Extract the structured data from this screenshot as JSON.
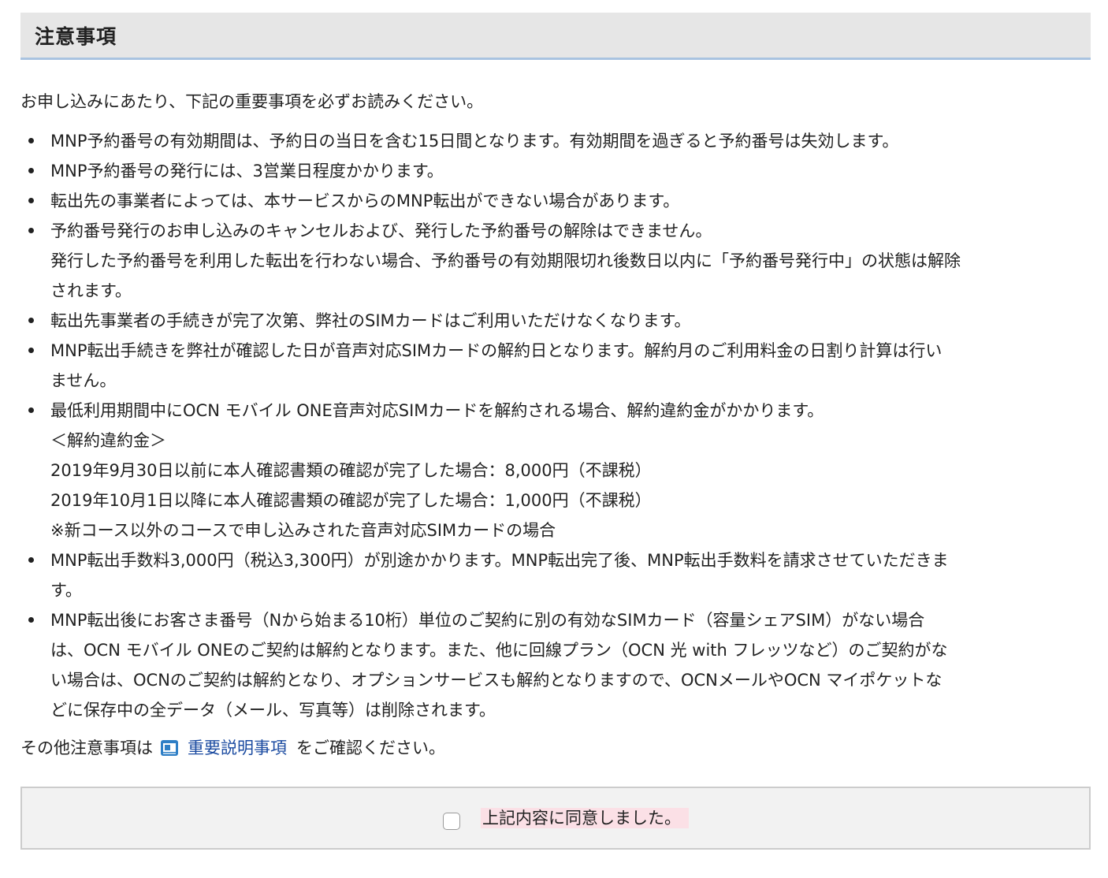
{
  "header": {
    "title": "注意事項"
  },
  "intro": "お申し込みにあたり、下記の重要事項を必ずお読みください。",
  "notices": [
    {
      "lines": [
        "MNP予約番号の有効期間は、予約日の当日を含む15日間となります。有効期間を過ぎると予約番号は失効します。"
      ]
    },
    {
      "lines": [
        "MNP予約番号の発行には、3営業日程度かかります。"
      ]
    },
    {
      "lines": [
        "転出先の事業者によっては、本サービスからのMNP転出ができない場合があります。"
      ]
    },
    {
      "lines": [
        "予約番号発行のお申し込みのキャンセルおよび、発行した予約番号の解除はできません。",
        "発行した予約番号を利用した転出を行わない場合、予約番号の有効期限切れ後数日以内に「予約番号発行中」の状態は解除",
        "されます。"
      ]
    },
    {
      "lines": [
        "転出先事業者の手続きが完了次第、弊社のSIMカードはご利用いただけなくなります。"
      ]
    },
    {
      "lines": [
        "MNP転出手続きを弊社が確認した日が音声対応SIMカードの解約日となります。解約月のご利用料金の日割り計算は行い",
        "ません。"
      ]
    },
    {
      "lines": [
        "最低利用期間中にOCN モバイル ONE音声対応SIMカードを解約される場合、解約違約金がかかります。",
        "＜解約違約金＞",
        "2019年9月30日以前に本人確認書類の確認が完了した場合：8,000円（不課税）",
        "2019年10月1日以降に本人確認書類の確認が完了した場合：1,000円（不課税）",
        "※新コース以外のコースで申し込みされた音声対応SIMカードの場合"
      ]
    },
    {
      "lines": [
        "MNP転出手数料3,000円（税込3,300円）が別途かかります。MNP転出完了後、MNP転出手数料を請求させていただきま",
        "す。"
      ]
    },
    {
      "lines": [
        "MNP転出後にお客さま番号（Nから始まる10桁）単位のご契約に別の有効なSIMカード（容量シェアSIM）がない場合",
        "は、OCN モバイル ONEのご契約は解約となります。また、他に回線プラン（OCN 光 with フレッツなど）のご契約がな",
        "い場合は、OCNのご契約は解約となり、オプションサービスも解約となりますので、OCNメールやOCN マイポケットな",
        "どに保存中の全データ（メール、写真等）は削除されます。"
      ]
    }
  ],
  "other_note": {
    "prefix": "その他注意事項は",
    "link_label": "重要説明事項",
    "suffix": "をご確認ください。",
    "icon": "document-window-icon",
    "icon_color": "#2f7fc6"
  },
  "agreement": {
    "label": "上記内容に同意しました。",
    "checked": false,
    "highlight_color": "#fbe0e6"
  },
  "colors": {
    "header_bg": "#e6e6e6",
    "header_border": "#a9c3e0",
    "link": "#1a4aa0"
  }
}
